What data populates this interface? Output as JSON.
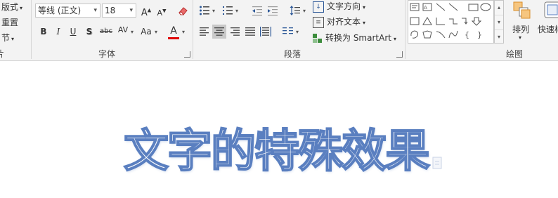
{
  "ribbon": {
    "slides_group": {
      "layout_label": "版式",
      "reset_label": "重置",
      "section_label": "节",
      "group_label": "片"
    },
    "font_group": {
      "group_label": "字体",
      "font_name": "等线 (正文)",
      "font_size": "18",
      "bold": "B",
      "italic": "I",
      "underline": "U",
      "shadow": "S",
      "strikethrough": "abc",
      "char_spacing": "AV",
      "change_case": "Aa",
      "font_color": "A",
      "font_color_value": "#e00000"
    },
    "paragraph_group": {
      "group_label": "段落",
      "text_direction_label": "文字方向",
      "align_text_label": "对齐文本",
      "smartart_label": "转换为 SmartArt"
    },
    "drawing_group": {
      "group_label": "绘图",
      "arrange_label": "排列",
      "quick_styles_label": "快速样"
    }
  },
  "slide": {
    "wordart_text": "文字的特殊效果",
    "outline_color": "#5a7fc0"
  }
}
